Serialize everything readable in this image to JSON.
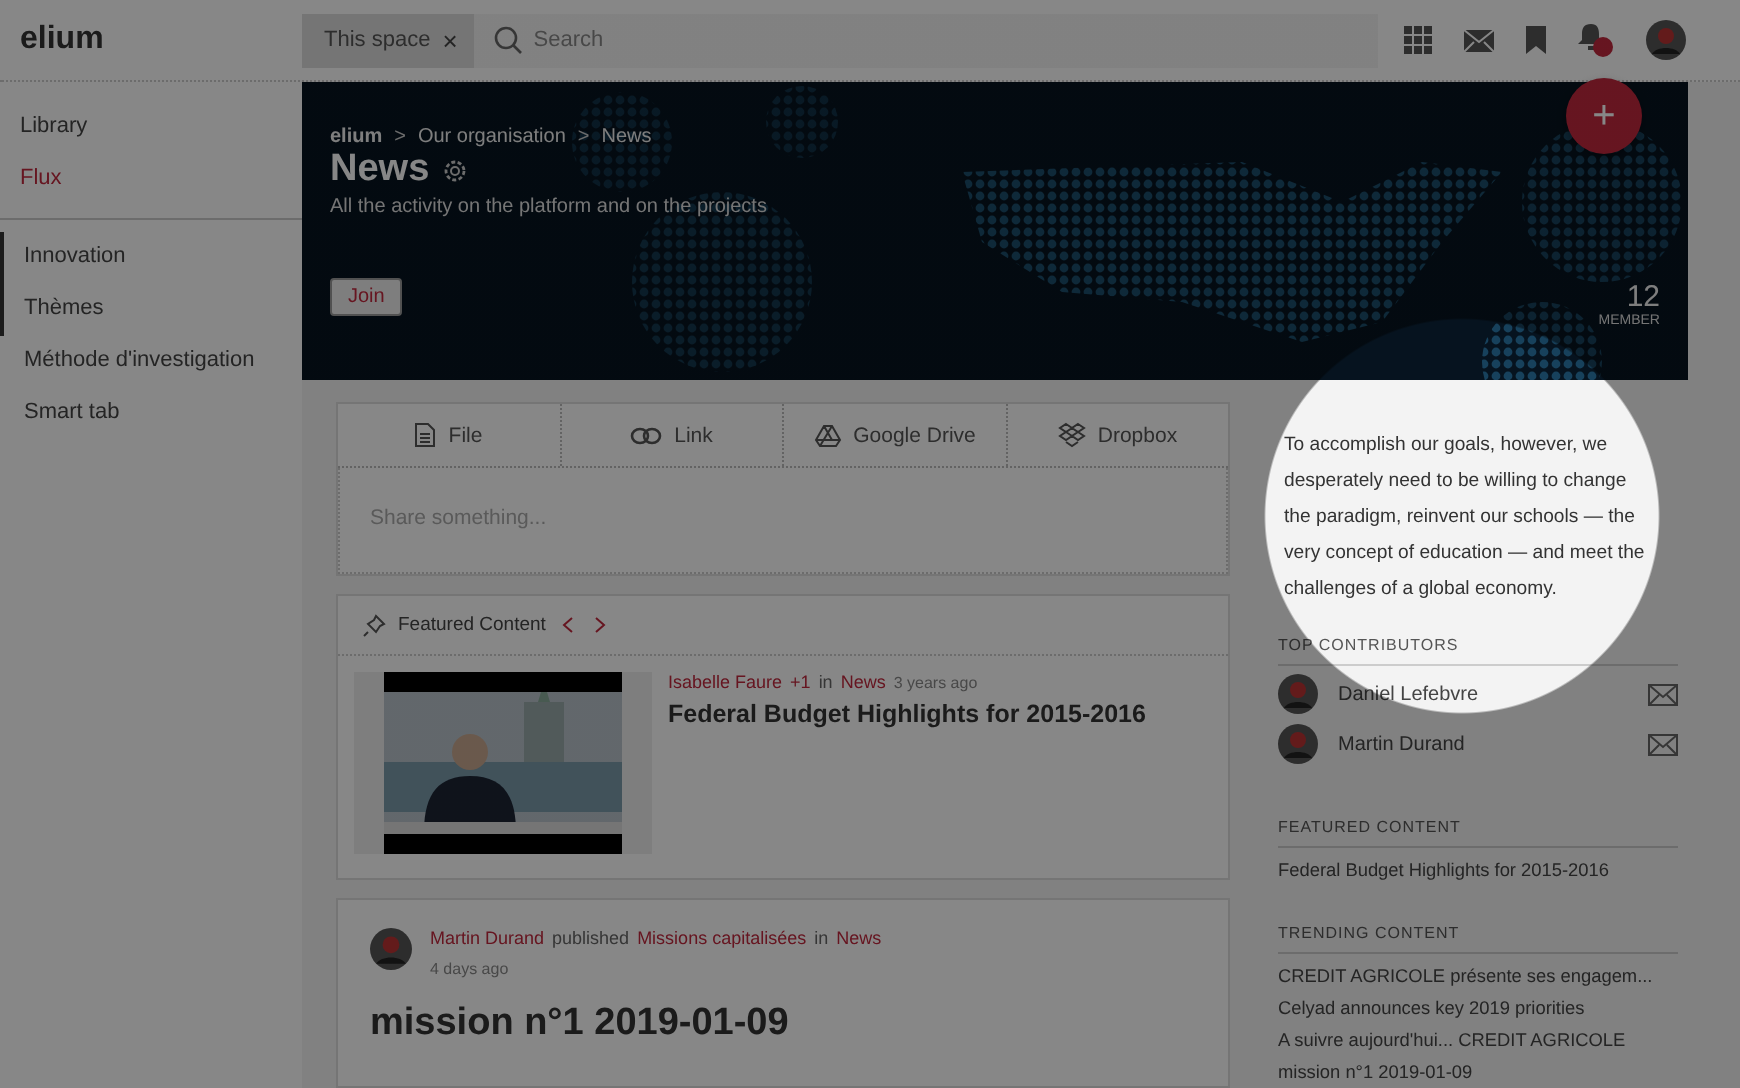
{
  "topbar": {
    "logo": "elium",
    "scope_chip": {
      "label": "This space",
      "close": "×"
    },
    "search": {
      "placeholder": "Search"
    }
  },
  "sidebar": {
    "items": [
      {
        "label": "Library",
        "selected": false
      },
      {
        "label": "Flux",
        "selected": true
      }
    ],
    "spaces": [
      {
        "label": "Innovation",
        "marker": true
      },
      {
        "label": "Thèmes",
        "marker": true
      },
      {
        "label": "Méthode d'investigation",
        "marker": false
      },
      {
        "label": "Smart tab",
        "marker": false
      }
    ]
  },
  "banner": {
    "breadcrumb_separator": ">",
    "breadcrumb": [
      "elium",
      "Our organisation",
      "News"
    ],
    "title": "News",
    "subtitle": "All the activity on the platform and on the projects",
    "join": "Join",
    "member_count": "12",
    "member_label": "MEMBER",
    "fab": "+"
  },
  "composer": {
    "tabs": [
      {
        "label": "File",
        "kind": "file"
      },
      {
        "label": "Link",
        "kind": "link"
      },
      {
        "label": "Google Drive",
        "kind": "drive"
      },
      {
        "label": "Dropbox",
        "kind": "dropbox"
      }
    ],
    "placeholder": "Share something..."
  },
  "featured": {
    "title": "Featured Content",
    "item": {
      "author": "Isabelle Faure",
      "extra": "+1",
      "preposition": "in",
      "space": "News",
      "time": "3 years ago",
      "title": "Federal Budget Highlights for 2015-2016"
    }
  },
  "post": {
    "author": "Martin Durand",
    "verb": "published",
    "target": "Missions capitalisées",
    "preposition": "in",
    "space": "News",
    "time": "4 days ago",
    "title": "mission n°1 2019-01-09"
  },
  "right": {
    "quote": "To accomplish our goals, however, we desperately need to be willing to change the paradigm, reinvent our schools — the very concept of education — and meet the challenges of a global economy.",
    "contributors_title": "TOP CONTRIBUTORS",
    "contributors": [
      {
        "name": "Daniel Lefebvre"
      },
      {
        "name": "Martin Durand"
      }
    ],
    "featured_title": "FEATURED CONTENT",
    "featured_items": [
      "Federal Budget Highlights for 2015-2016"
    ],
    "trending_title": "TRENDING CONTENT",
    "trending_items": [
      "CREDIT AGRICOLE présente ses engagem...",
      "Celyad announces key 2019 priorities",
      "A suivre aujourd'hui... CREDIT AGRICOLE",
      "mission n°1 2019-01-09"
    ]
  }
}
